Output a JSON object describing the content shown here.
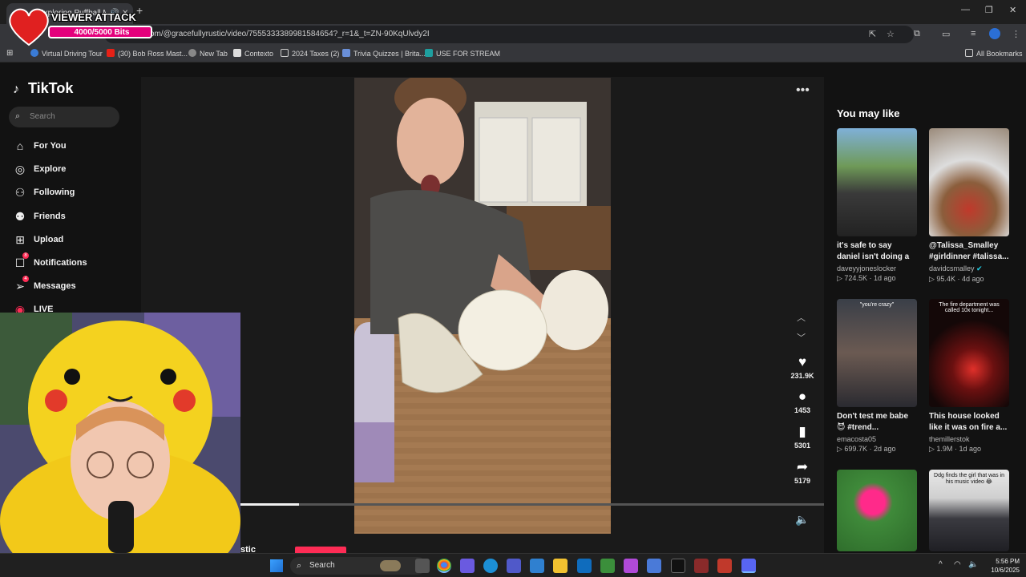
{
  "browser": {
    "tab_title": "Exploring Puffball Mushro...",
    "url": "com/@gracefullyrustic/video/7555333389981584654?_r=1&_t=ZN-90KqUlvdy2I",
    "bookmarks": [
      "Virtual Driving Tour",
      "(30) Bob Ross Mast...",
      "New Tab",
      "Contexto",
      "2024 Taxes (2)",
      "Trivia Quizzes | Brita...",
      "USE FOR STREAM"
    ],
    "all_bookmarks": "All Bookmarks",
    "new_tab_symbol": "+"
  },
  "overlay": {
    "viewer_attack_title": "VIEWER ATTACK",
    "bits_text": "4000/5000 Bits",
    "bits_progress": 0.8
  },
  "tiktok": {
    "logo": "TikTok",
    "search_placeholder": "Search",
    "nav": [
      {
        "label": "For You",
        "icon": "home-icon"
      },
      {
        "label": "Explore",
        "icon": "compass-icon"
      },
      {
        "label": "Following",
        "icon": "following-icon"
      },
      {
        "label": "Friends",
        "icon": "friends-icon"
      },
      {
        "label": "Upload",
        "icon": "upload-icon"
      },
      {
        "label": "Notifications",
        "icon": "bell-icon",
        "badge": "8"
      },
      {
        "label": "Messages",
        "icon": "message-icon",
        "badge": "4"
      },
      {
        "label": "LIVE",
        "icon": "live-icon"
      }
    ],
    "actions": {
      "likes": "231.9K",
      "comments": "1453",
      "saves": "5301",
      "shares": "5179"
    },
    "video_progress": 0.1,
    "author_partial": "stic",
    "you_may_like": "You may like",
    "suggestions": [
      {
        "caption": "it's safe to say daniel isn't doing a pop u...",
        "handle": "daveyyjoneslocker",
        "views": "724.5K",
        "age": "1d ago",
        "verified": false,
        "thumb_text": ""
      },
      {
        "caption": "@Talissa_Smalley #girldinner #talissa...",
        "handle": "davidcsmalley",
        "views": "95.4K",
        "age": "4d ago",
        "verified": true,
        "thumb_text": ""
      },
      {
        "caption": "Don't test me babe 😈 #trend...",
        "handle": "emacosta05",
        "views": "699.7K",
        "age": "2d ago",
        "verified": false,
        "thumb_text": "\"you're crazy\""
      },
      {
        "caption": "This house looked like it was on fire a...",
        "handle": "themillerstok",
        "views": "1.9M",
        "age": "1d ago",
        "verified": false,
        "thumb_text": "The fire department was called 10x tonight..."
      },
      {
        "caption": "",
        "handle": "",
        "views": "",
        "age": "",
        "verified": false,
        "thumb_text": ""
      },
      {
        "caption": "",
        "handle": "",
        "views": "",
        "age": "",
        "verified": false,
        "thumb_text": "Ddg finds the girl that was in his music video 😂"
      }
    ]
  },
  "taskbar": {
    "search": "Search",
    "time": "5:56 PM",
    "date": "10/6/2025"
  },
  "colors": {
    "accent": "#fe2c55",
    "bits_bar": "#e4007c",
    "background": "#121212"
  }
}
